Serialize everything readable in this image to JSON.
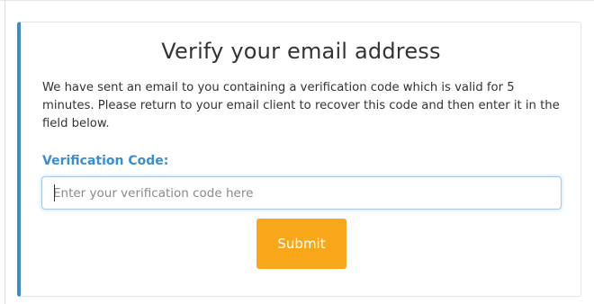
{
  "verify_card": {
    "title": "Verify your email address",
    "message": "We have sent an email to you containing a verification code which is valid for 5 minutes. Please return to your email client to recover this code and then enter it in the field below.",
    "code_label": "Verification Code:",
    "code_input": {
      "value": "",
      "placeholder": "Enter your verification code here"
    },
    "submit_label": "Submit"
  },
  "colors": {
    "accent": "#3c8dcb",
    "button": "#f9a71a",
    "text": "#333333"
  }
}
